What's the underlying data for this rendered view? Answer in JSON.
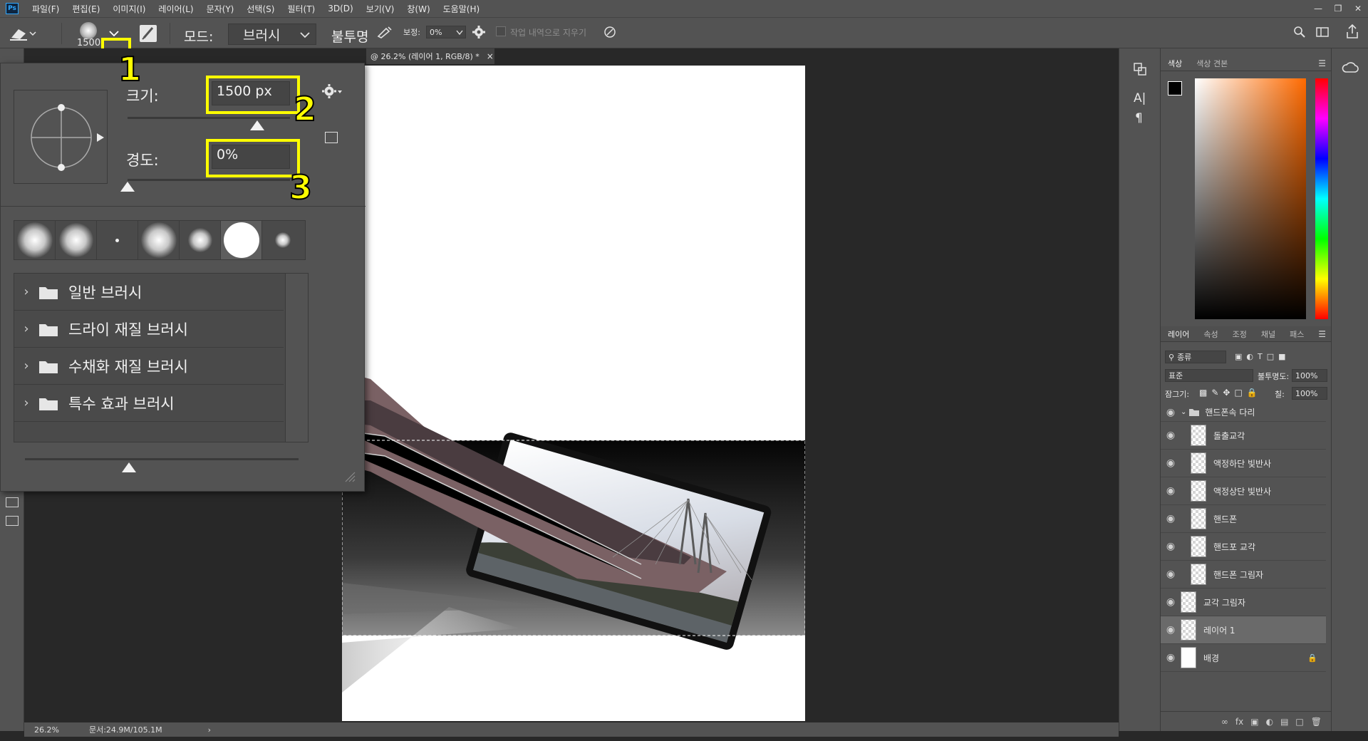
{
  "app": {
    "logo": "Ps",
    "menus": [
      "파일(F)",
      "편집(E)",
      "이미지(I)",
      "레이어(L)",
      "문자(Y)",
      "선택(S)",
      "필터(T)",
      "3D(D)",
      "보기(V)",
      "창(W)",
      "도움말(H)"
    ]
  },
  "options_bar": {
    "brush_size": "1500",
    "mode_label": "모드:",
    "mode_value": "브러시",
    "opacity_label": "불투명",
    "smoothing_label": "보정:",
    "smoothing_value": "0%",
    "erase_history_label": "작업 내역으로 지우기"
  },
  "document": {
    "tab_title": "@ 26.2% (레이어 1, RGB/8) *",
    "zoom": "26.2%",
    "doc_info": "문서:24.9M/105.1M"
  },
  "brush_popup": {
    "size_label": "크기:",
    "size_value": "1500 px",
    "hardness_label": "경도:",
    "hardness_value": "0%",
    "size_slider_percent": 80,
    "hardness_slider_percent": 0,
    "folders": [
      "일반 브러시",
      "드라이 재질 브러시",
      "수채화 재질 브러시",
      "특수 효과 브러시"
    ]
  },
  "callouts": [
    "1",
    "2",
    "3"
  ],
  "colors": {
    "highlight": "#ffff00",
    "ui_gray": "#535353",
    "canvas_bg": "#282828"
  },
  "color_panel": {
    "tabs": [
      "색상",
      "색상 견본"
    ]
  },
  "layers_panel": {
    "tabs": [
      "레이어",
      "속성",
      "조정",
      "채널",
      "패스"
    ],
    "filter_label": "종류",
    "blend_mode": "표준",
    "opacity_label": "불투명도:",
    "opacity_value": "100%",
    "lock_label": "잠그기:",
    "fill_label": "칠:",
    "fill_value": "100%",
    "group_name": "핸드폰속 다리",
    "layers": [
      {
        "name": "돌출교각",
        "indent": true
      },
      {
        "name": "액정하단 빛반사",
        "indent": true
      },
      {
        "name": "액정상단 빛반사",
        "indent": true
      },
      {
        "name": "핸드폰",
        "indent": true
      },
      {
        "name": "핸드포 교각",
        "indent": true
      },
      {
        "name": "핸드폰 그림자",
        "indent": true
      },
      {
        "name": "교각 그림자",
        "indent": false
      },
      {
        "name": "레이어 1",
        "indent": false,
        "selected": true
      },
      {
        "name": "배경",
        "indent": false,
        "locked": true
      }
    ]
  }
}
